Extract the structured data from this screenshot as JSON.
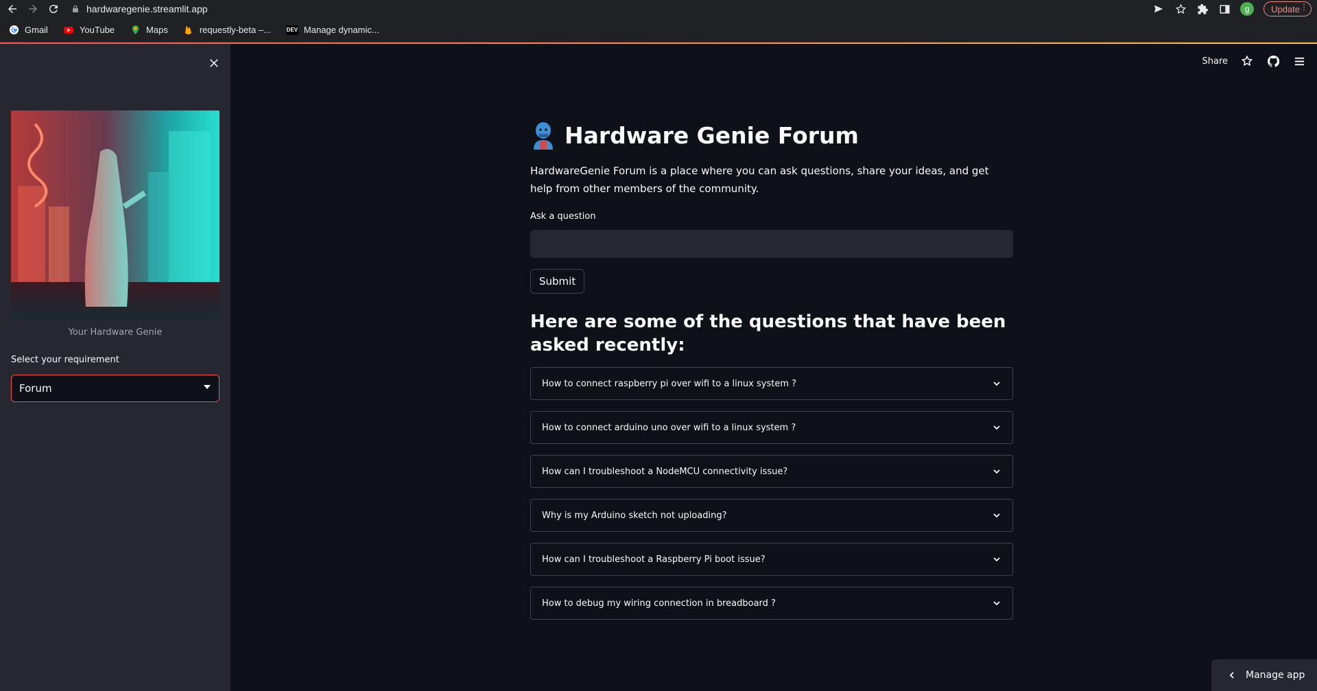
{
  "browser": {
    "url": "hardwaregenie.streamlit.app",
    "update_label": "Update",
    "profile_initial": "g",
    "bookmarks": [
      {
        "label": "Gmail",
        "icon": "google-icon"
      },
      {
        "label": "YouTube",
        "icon": "youtube-icon"
      },
      {
        "label": "Maps",
        "icon": "maps-icon"
      },
      {
        "label": "requestly-beta –...",
        "icon": "firebase-icon"
      },
      {
        "label": "Manage dynamic...",
        "icon": "dev-icon",
        "badge": "DEV"
      }
    ]
  },
  "sidebar": {
    "image_caption": "Your Hardware Genie",
    "select_label": "Select your requirement",
    "select_value": "Forum"
  },
  "header": {
    "share_label": "Share"
  },
  "main": {
    "title_emoji": "genie-icon",
    "title": "Hardware Genie Forum",
    "intro": "HardwareGenie Forum is a place where you can ask questions, share your ideas, and get help from other members of the community.",
    "question_label": "Ask a question",
    "question_value": "",
    "submit_label": "Submit",
    "recent_heading": "Here are some of the questions that have been asked recently:",
    "faqs": [
      "How to connect raspberry pi over wifi to a linux system ?",
      "How to connect arduino uno over wifi to a linux system ?",
      "How can I troubleshoot a NodeMCU connectivity issue?",
      "Why is my Arduino sketch not uploading?",
      "How can I troubleshoot a Raspberry Pi boot issue?",
      "How to debug my wiring connection in breadboard ?"
    ]
  },
  "footer": {
    "manage_app_label": "Manage app"
  },
  "colors": {
    "background": "#0e1117",
    "sidebar": "#262730",
    "accent": "#ff4b4b",
    "text": "#fafafa"
  }
}
